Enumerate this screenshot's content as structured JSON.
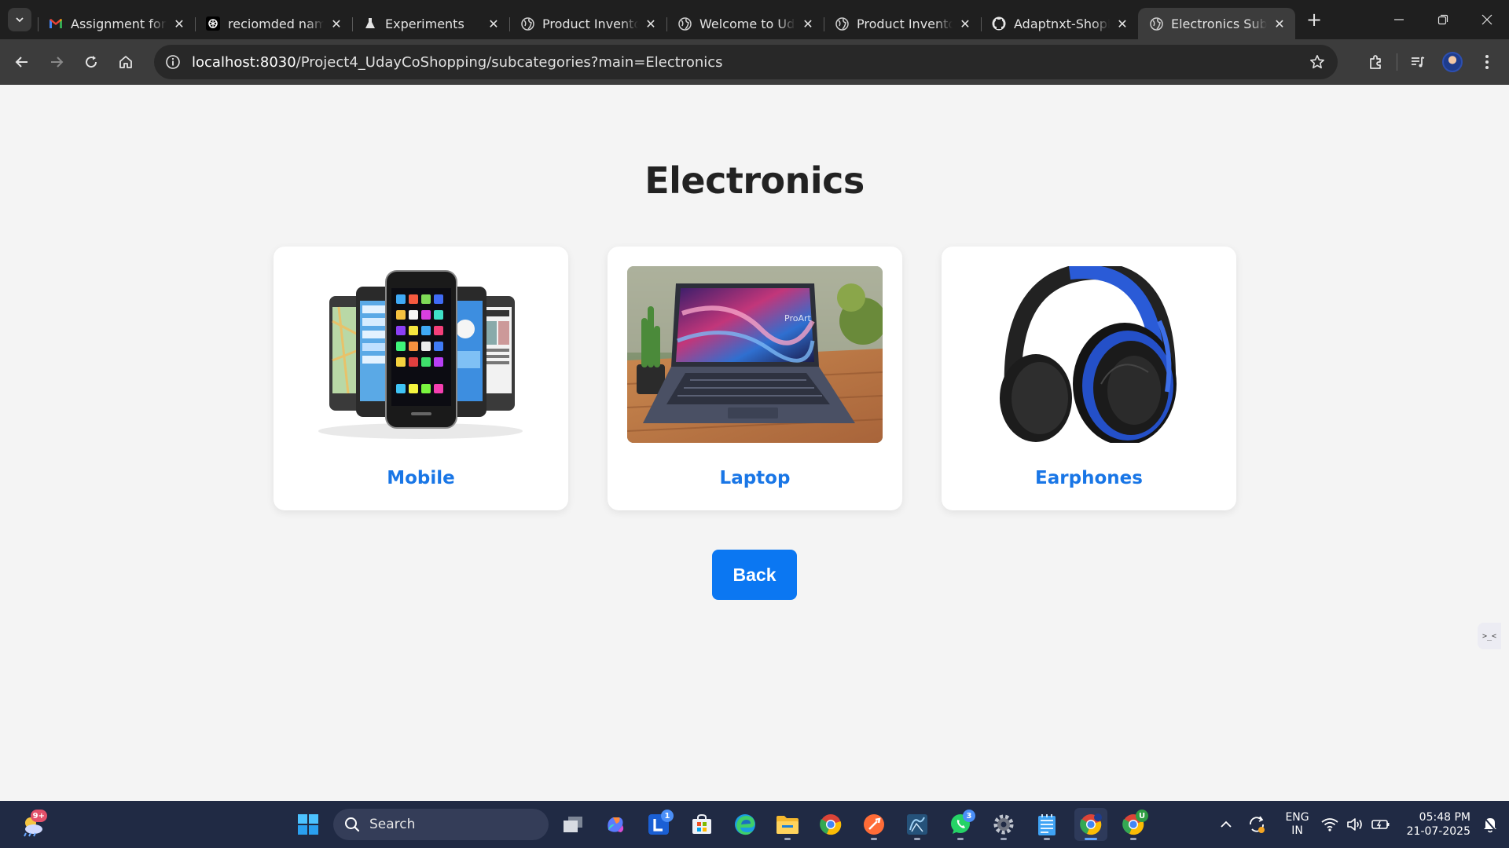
{
  "browser": {
    "tabs": [
      {
        "title": "Assignment for E",
        "icon": "gmail-icon",
        "active": false
      },
      {
        "title": "reciomded name",
        "icon": "openai-icon",
        "active": false
      },
      {
        "title": "Experiments",
        "icon": "flask-icon",
        "active": false
      },
      {
        "title": "Product Inventor",
        "icon": "globe-icon",
        "active": false
      },
      {
        "title": "Welcome to Uda",
        "icon": "globe-icon",
        "active": false
      },
      {
        "title": "Product Inventor",
        "icon": "globe-icon",
        "active": false
      },
      {
        "title": "Adaptnxt-ShopE",
        "icon": "github-icon",
        "active": false
      },
      {
        "title": "Electronics Subc",
        "icon": "globe-icon",
        "active": true
      }
    ],
    "url_host": "localhost:8030",
    "url_path": "/Project4_UdayCoShopping/subcategories?main=Electronics"
  },
  "page": {
    "title": "Electronics",
    "categories": [
      {
        "label": "Mobile",
        "image": "smartphones-image"
      },
      {
        "label": "Laptop",
        "image": "laptop-image"
      },
      {
        "label": "Earphones",
        "image": "headphones-image"
      }
    ],
    "back_label": "Back",
    "side_widget": ">_<"
  },
  "taskbar": {
    "search_label": "Search",
    "weather_badge": "9+",
    "badges": {
      "linkedin": "1",
      "whatsapp": "3",
      "chrome_profile": "U"
    },
    "lang_line1": "ENG",
    "lang_line2": "IN",
    "time": "05:48 PM",
    "date": "21-07-2025"
  },
  "colors": {
    "accent": "#0b77f2",
    "label": "#1976e6",
    "taskbar": "#202a44"
  }
}
